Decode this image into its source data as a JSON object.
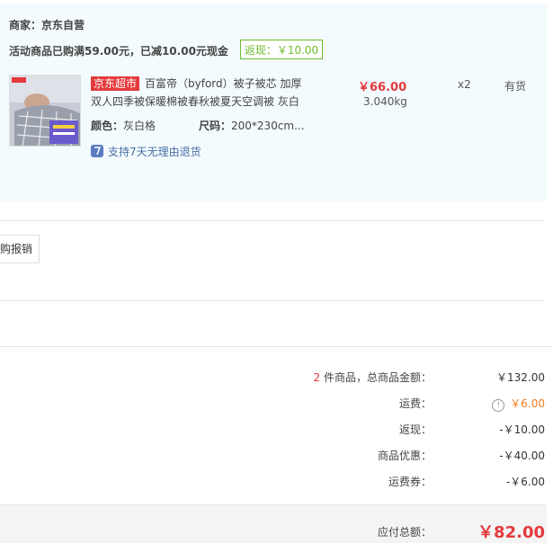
{
  "shop": {
    "label": "商家：",
    "name": "京东自营"
  },
  "promo": {
    "text": "活动商品已购满59.00元，已减10.00元现金",
    "rebate_tag": "返现：￥10.00"
  },
  "item": {
    "badge": "京东超市",
    "title_line1": "百富帝（byford）被子被芯 加厚",
    "title_line2": "双人四季被保暖棉被春秋被夏天空调被 灰白",
    "color_label": "颜色：",
    "color_value": "灰白格",
    "size_label": "尺码：",
    "size_value": "200*230cm...",
    "price": "￥66.00",
    "weight": "3.040kg",
    "qty": "x2",
    "stock": "有货",
    "return_policy": "支持7天无理由退货"
  },
  "invoice": {
    "button_label": "购报销"
  },
  "summary": {
    "count": "2",
    "count_suffix": " 件商品，总商品金额：",
    "goods_total": "￥132.00",
    "shipping_label": "运费：",
    "shipping_value": "￥6.00",
    "rebate_label": "返现：",
    "rebate_value": "-￥10.00",
    "discount_label": "商品优惠：",
    "discount_value": "-￥40.00",
    "coupon_label": "运费券：",
    "coupon_value": "-￥6.00",
    "payable_label": "应付总额：",
    "payable_value": "￥82.00"
  },
  "colors": {
    "accent_red": "#e4393c",
    "rebate_green": "#6fba2c",
    "shipping_orange": "#f37b1d",
    "panel_bg": "#f3fbfe"
  },
  "icons": {
    "return_policy": "return-7days-icon",
    "shipping_info": "info-circle-icon"
  }
}
